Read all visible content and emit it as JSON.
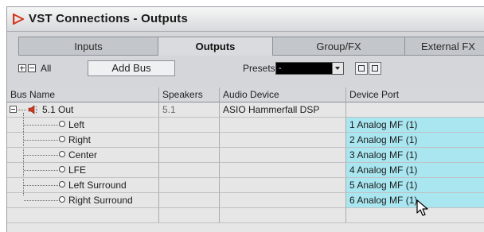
{
  "window": {
    "title": "VST Connections - Outputs"
  },
  "tabs": [
    {
      "label": "Inputs",
      "active": false
    },
    {
      "label": "Outputs",
      "active": true
    },
    {
      "label": "Group/FX",
      "active": false
    },
    {
      "label": "External FX",
      "active": false
    }
  ],
  "toolbar": {
    "all_label": "All",
    "add_bus_label": "Add Bus",
    "presets_label": "Presets",
    "presets_value": "-"
  },
  "table": {
    "columns": [
      "Bus Name",
      "Speakers",
      "Audio Device",
      "Device Port"
    ],
    "bus": {
      "name": "5.1 Out",
      "speakers": "5.1",
      "audio_device": "ASIO Hammerfall DSP",
      "device_port": ""
    },
    "channels": [
      {
        "name": "Left",
        "port": "1 Analog MF (1)"
      },
      {
        "name": "Right",
        "port": "2 Analog MF (1)"
      },
      {
        "name": "Center",
        "port": "3 Analog MF (1)"
      },
      {
        "name": "LFE",
        "port": "4 Analog MF (1)"
      },
      {
        "name": "Left Surround",
        "port": "5 Analog MF (1)"
      },
      {
        "name": "Right Surround",
        "port": "6 Analog MF (1)"
      }
    ]
  },
  "colors": {
    "assigned_port_bg": "#a9e6f0",
    "window_bg": "#d4d6d9",
    "logo_red": "#d2381f"
  },
  "icons": [
    "vst-logo-icon",
    "expand-all-icon",
    "collapse-all-icon",
    "collapse-icon",
    "speaker-icon",
    "port-connector-icon",
    "mouse-pointer-icon"
  ]
}
